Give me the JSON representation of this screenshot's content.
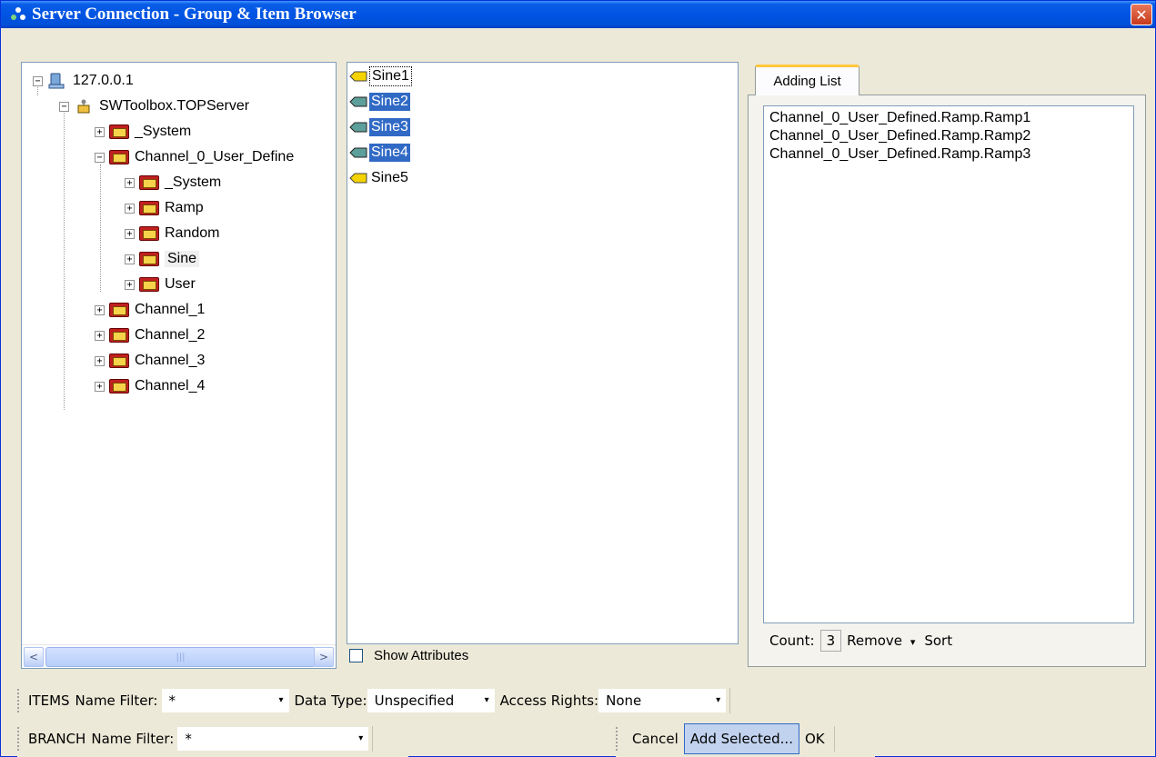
{
  "window": {
    "title": "Server Connection - Group & Item Browser",
    "close_label": "✕"
  },
  "tree": {
    "nodes": [
      {
        "label": "127.0.0.1",
        "expander": "−",
        "icon": "computer-icon"
      },
      {
        "label": "SWToolbox.TOPServer",
        "expander": "−",
        "icon": "server-icon"
      },
      {
        "label": "_System",
        "expander": "+",
        "icon": "folder-icon"
      },
      {
        "label": "Channel_0_User_Define",
        "expander": "−",
        "icon": "folder-icon"
      },
      {
        "label": "_System",
        "expander": "+",
        "icon": "folder-icon"
      },
      {
        "label": "Ramp",
        "expander": "+",
        "icon": "folder-icon"
      },
      {
        "label": "Random",
        "expander": "+",
        "icon": "folder-icon"
      },
      {
        "label": "Sine",
        "expander": "+",
        "icon": "folder-icon"
      },
      {
        "label": "User",
        "expander": "+",
        "icon": "folder-icon"
      },
      {
        "label": "Channel_1",
        "expander": "+",
        "icon": "folder-icon"
      },
      {
        "label": "Channel_2",
        "expander": "+",
        "icon": "folder-icon"
      },
      {
        "label": "Channel_3",
        "expander": "+",
        "icon": "folder-icon"
      },
      {
        "label": "Channel_4",
        "expander": "+",
        "icon": "folder-icon"
      }
    ],
    "scroll_left": "<",
    "scroll_right": ">",
    "scroll_grip": "|||"
  },
  "items": {
    "rows": [
      {
        "label": "Sine1",
        "selected": false,
        "focused": true
      },
      {
        "label": "Sine2",
        "selected": true
      },
      {
        "label": "Sine3",
        "selected": true
      },
      {
        "label": "Sine4",
        "selected": true
      },
      {
        "label": "Sine5",
        "selected": false
      }
    ],
    "show_attributes_label": "Show Attributes",
    "show_attributes_checked": false
  },
  "adding": {
    "tab_label": "Adding List",
    "entries": [
      "Channel_0_User_Defined.Ramp.Ramp1",
      "Channel_0_User_Defined.Ramp.Ramp2",
      "Channel_0_User_Defined.Ramp.Ramp3"
    ],
    "count_label": "Count:",
    "count_value": "3",
    "remove_label": "Remove",
    "remove_arrow": "▾",
    "sort_label": "Sort"
  },
  "items_toolbar": {
    "section_label": "ITEMS",
    "name_filter_label": "Name Filter:",
    "name_filter_value": "*",
    "data_type_label": "Data Type:",
    "data_type_value": "Unspecified",
    "access_rights_label": "Access Rights:",
    "access_rights_value": "None"
  },
  "branch_toolbar": {
    "section_label": "BRANCH",
    "name_filter_label": "Name Filter:",
    "name_filter_value": "*",
    "cancel_label": "Cancel",
    "add_selected_label": "Add Selected...",
    "ok_label": "OK"
  },
  "dropdown_arrow": "▾",
  "colors": {
    "selection": "#316ac5",
    "titlebar": "#0054e3",
    "tab_highlight": "#ffc83c"
  }
}
